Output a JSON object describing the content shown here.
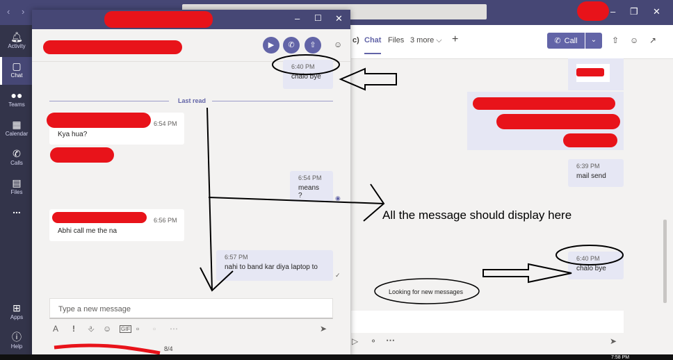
{
  "main": {
    "tabs": [
      "c)",
      "Chat",
      "Files",
      "3 more ⌵"
    ],
    "call_label": "Call",
    "messages": [
      {
        "time": "6:39 PM",
        "text": "mail send"
      },
      {
        "time": "6:40 PM",
        "text": "chalo bye"
      }
    ],
    "looking_text": "Looking for new messages",
    "annotation": "All the message should display here",
    "taskbar_time": "7:58 PM"
  },
  "rail": {
    "items": [
      {
        "label": "Activity",
        "icon": "bell-icon"
      },
      {
        "label": "Chat",
        "icon": "chat-icon"
      },
      {
        "label": "Teams",
        "icon": "teams-icon"
      },
      {
        "label": "Calendar",
        "icon": "calendar-icon"
      },
      {
        "label": "Calls",
        "icon": "phone-icon"
      },
      {
        "label": "Files",
        "icon": "files-icon"
      },
      {
        "label": "...",
        "icon": "more-icon"
      },
      {
        "label": "Apps",
        "icon": "apps-icon"
      },
      {
        "label": "Help",
        "icon": "help-icon"
      }
    ]
  },
  "popout": {
    "last_read": "Last read",
    "messages": [
      {
        "time": "6:40 PM",
        "text": "chalo bye",
        "side": "sent"
      },
      {
        "time": "6:54 PM",
        "text": "Kya hua?",
        "side": "received"
      },
      {
        "time": "6:54 PM",
        "text": "means ?",
        "side": "sent"
      },
      {
        "time": "6:56 PM",
        "text": "Abhi call me the na",
        "side": "received"
      },
      {
        "time": "6:57 PM",
        "text": "nahi to band kar diya laptop to",
        "side": "sent"
      }
    ],
    "compose_placeholder": "Type a new message"
  },
  "bottom": {
    "date_fragment": "8/4"
  },
  "colors": {
    "brand": "#6264a7",
    "rail": "#33344a",
    "titlebar": "#464775",
    "redaction": "#e8131a"
  }
}
